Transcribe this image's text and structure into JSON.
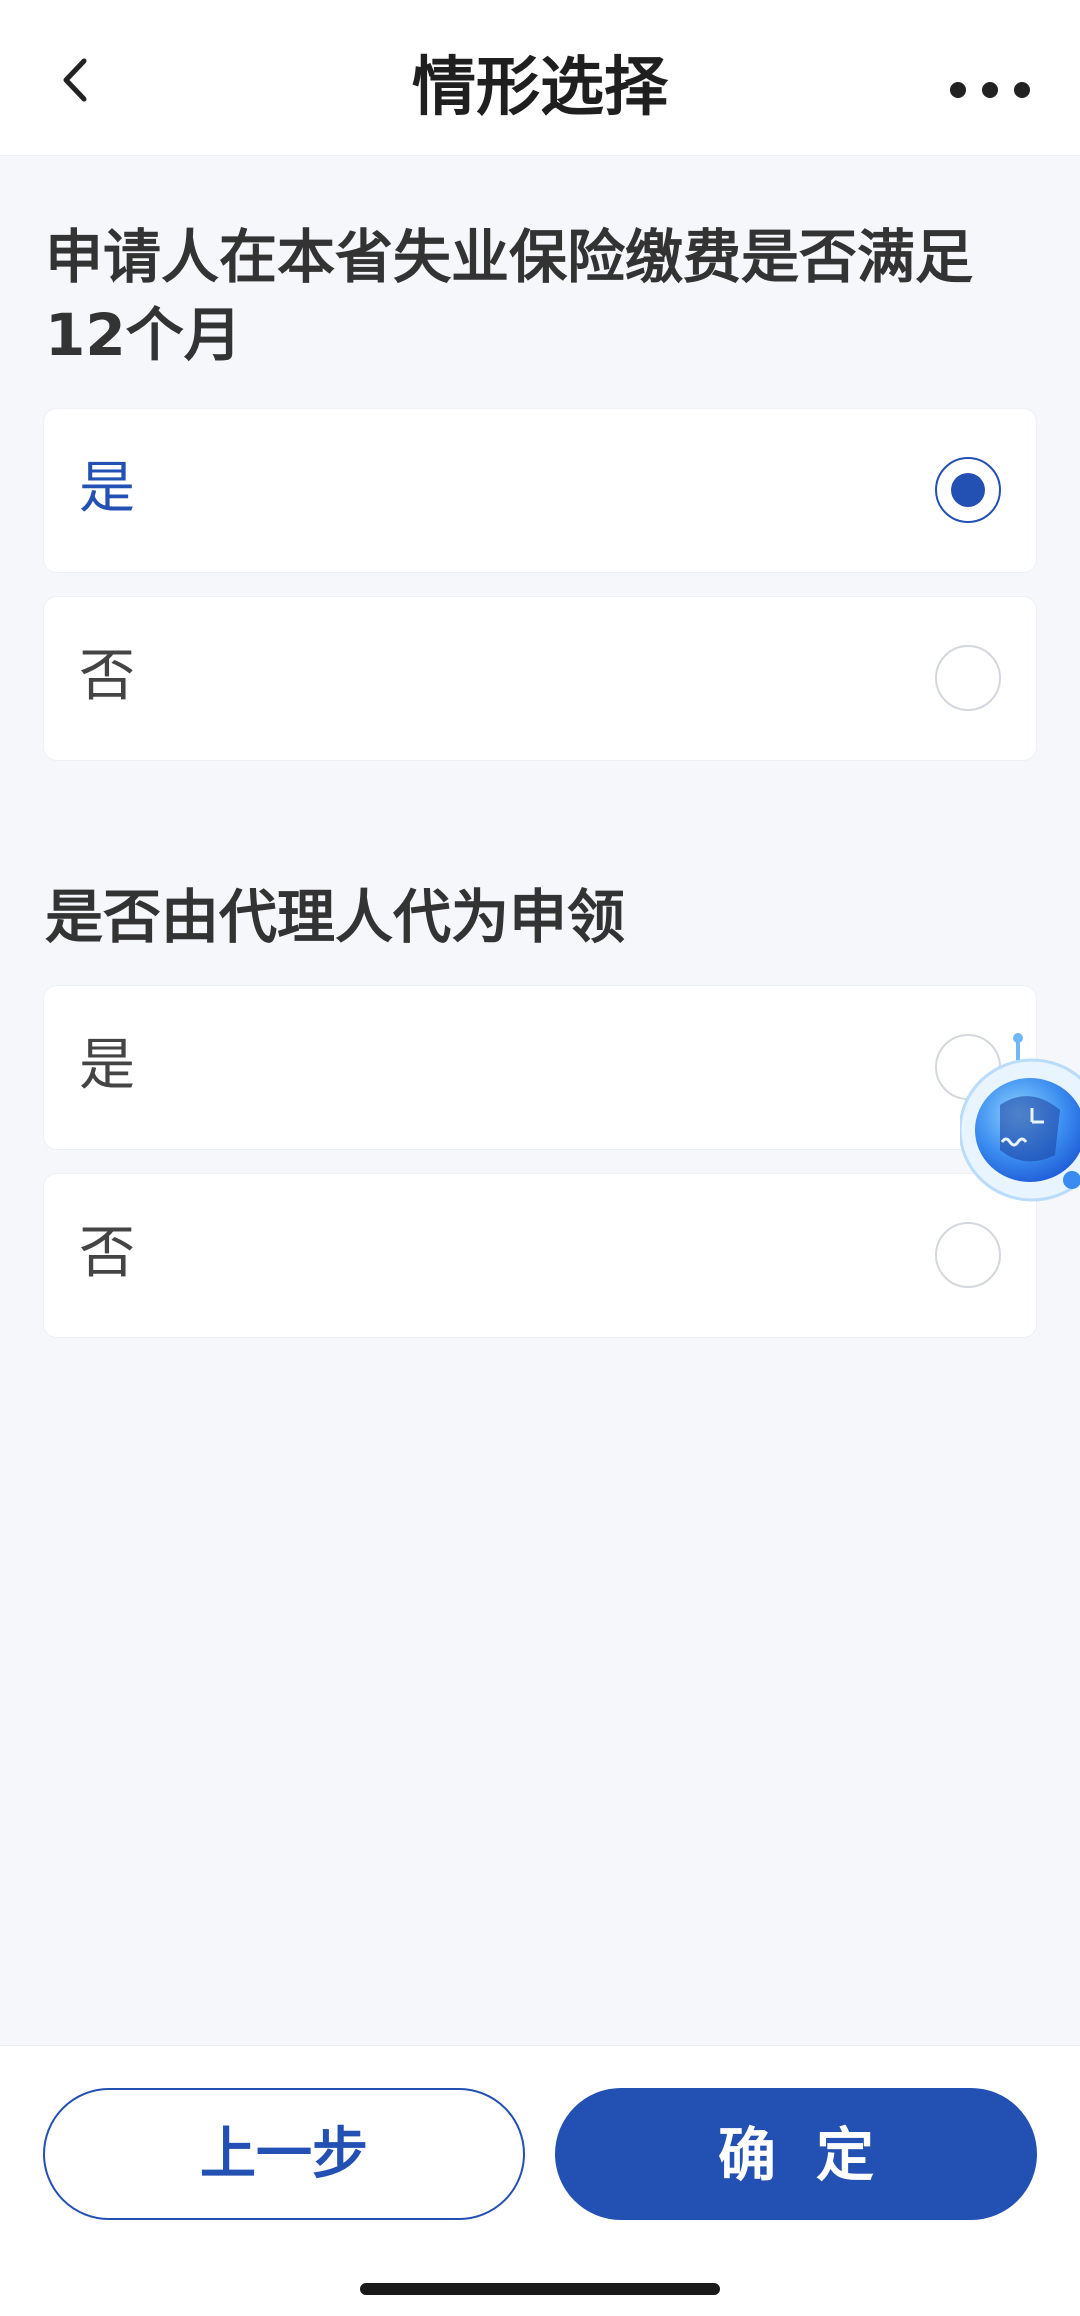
{
  "header": {
    "title": "情形选择",
    "back_icon": "chevron-left-icon",
    "more_icon": "more-horizontal-icon"
  },
  "questions": [
    {
      "title": "申请人在本省失业保险缴费是否满足12个月",
      "options": [
        {
          "label": "是",
          "selected": true
        },
        {
          "label": "否",
          "selected": false
        }
      ]
    },
    {
      "title": "是否由代理人代为申领",
      "options": [
        {
          "label": "是",
          "selected": false
        },
        {
          "label": "否",
          "selected": false
        }
      ]
    }
  ],
  "assistant": {
    "icon": "robot-assistant-icon"
  },
  "footer": {
    "prev_label": "上一步",
    "confirm_label": "确定"
  },
  "colors": {
    "accent": "#2350b3",
    "background": "#f5f7fa",
    "card": "#ffffff"
  }
}
